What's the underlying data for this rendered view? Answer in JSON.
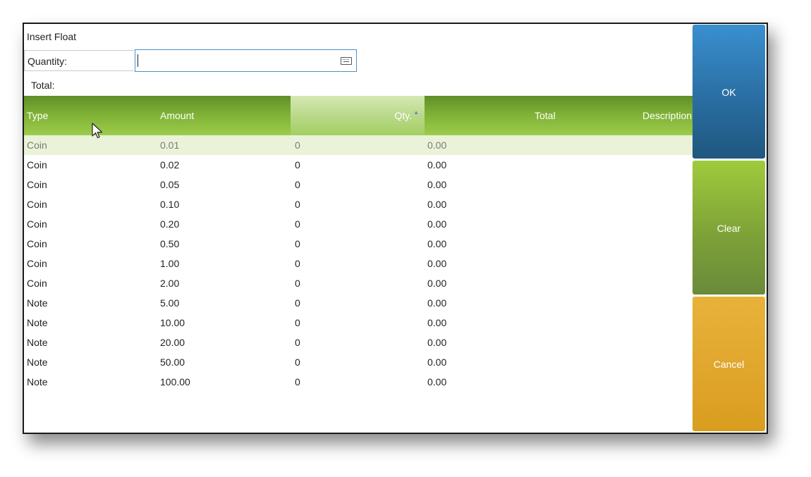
{
  "dialog": {
    "title": "Insert Float",
    "quantity_label": "Quantity:",
    "quantity_value": "",
    "total_label": "Total:"
  },
  "grid": {
    "columns": [
      "Type",
      "Amount",
      "Qty.",
      "Total",
      "Description"
    ],
    "sort_column": "Qty.",
    "rows": [
      {
        "type": "Coin",
        "amount": "0.01",
        "qty": "0",
        "total": "0.00",
        "description": ""
      },
      {
        "type": "Coin",
        "amount": "0.02",
        "qty": "0",
        "total": "0.00",
        "description": ""
      },
      {
        "type": "Coin",
        "amount": "0.05",
        "qty": "0",
        "total": "0.00",
        "description": ""
      },
      {
        "type": "Coin",
        "amount": "0.10",
        "qty": "0",
        "total": "0.00",
        "description": ""
      },
      {
        "type": "Coin",
        "amount": "0.20",
        "qty": "0",
        "total": "0.00",
        "description": ""
      },
      {
        "type": "Coin",
        "amount": "0.50",
        "qty": "0",
        "total": "0.00",
        "description": ""
      },
      {
        "type": "Coin",
        "amount": "1.00",
        "qty": "0",
        "total": "0.00",
        "description": ""
      },
      {
        "type": "Coin",
        "amount": "2.00",
        "qty": "0",
        "total": "0.00",
        "description": ""
      },
      {
        "type": "Note",
        "amount": "5.00",
        "qty": "0",
        "total": "0.00",
        "description": ""
      },
      {
        "type": "Note",
        "amount": "10.00",
        "qty": "0",
        "total": "0.00",
        "description": ""
      },
      {
        "type": "Note",
        "amount": "20.00",
        "qty": "0",
        "total": "0.00",
        "description": ""
      },
      {
        "type": "Note",
        "amount": "50.00",
        "qty": "0",
        "total": "0.00",
        "description": ""
      },
      {
        "type": "Note",
        "amount": "100.00",
        "qty": "0",
        "total": "0.00",
        "description": ""
      }
    ]
  },
  "buttons": {
    "ok": "OK",
    "clear": "Clear",
    "cancel": "Cancel"
  },
  "colors": {
    "header_green": "#7eb035",
    "ok_blue": "#2a6ea3",
    "clear_green": "#7ea238",
    "cancel_orange": "#e0a62d",
    "selected_row": "#eaf3d8"
  },
  "icons": {
    "keyboard": "keyboard-icon",
    "sort": "sort-ascending-icon",
    "cursor": "mouse-pointer-icon"
  }
}
